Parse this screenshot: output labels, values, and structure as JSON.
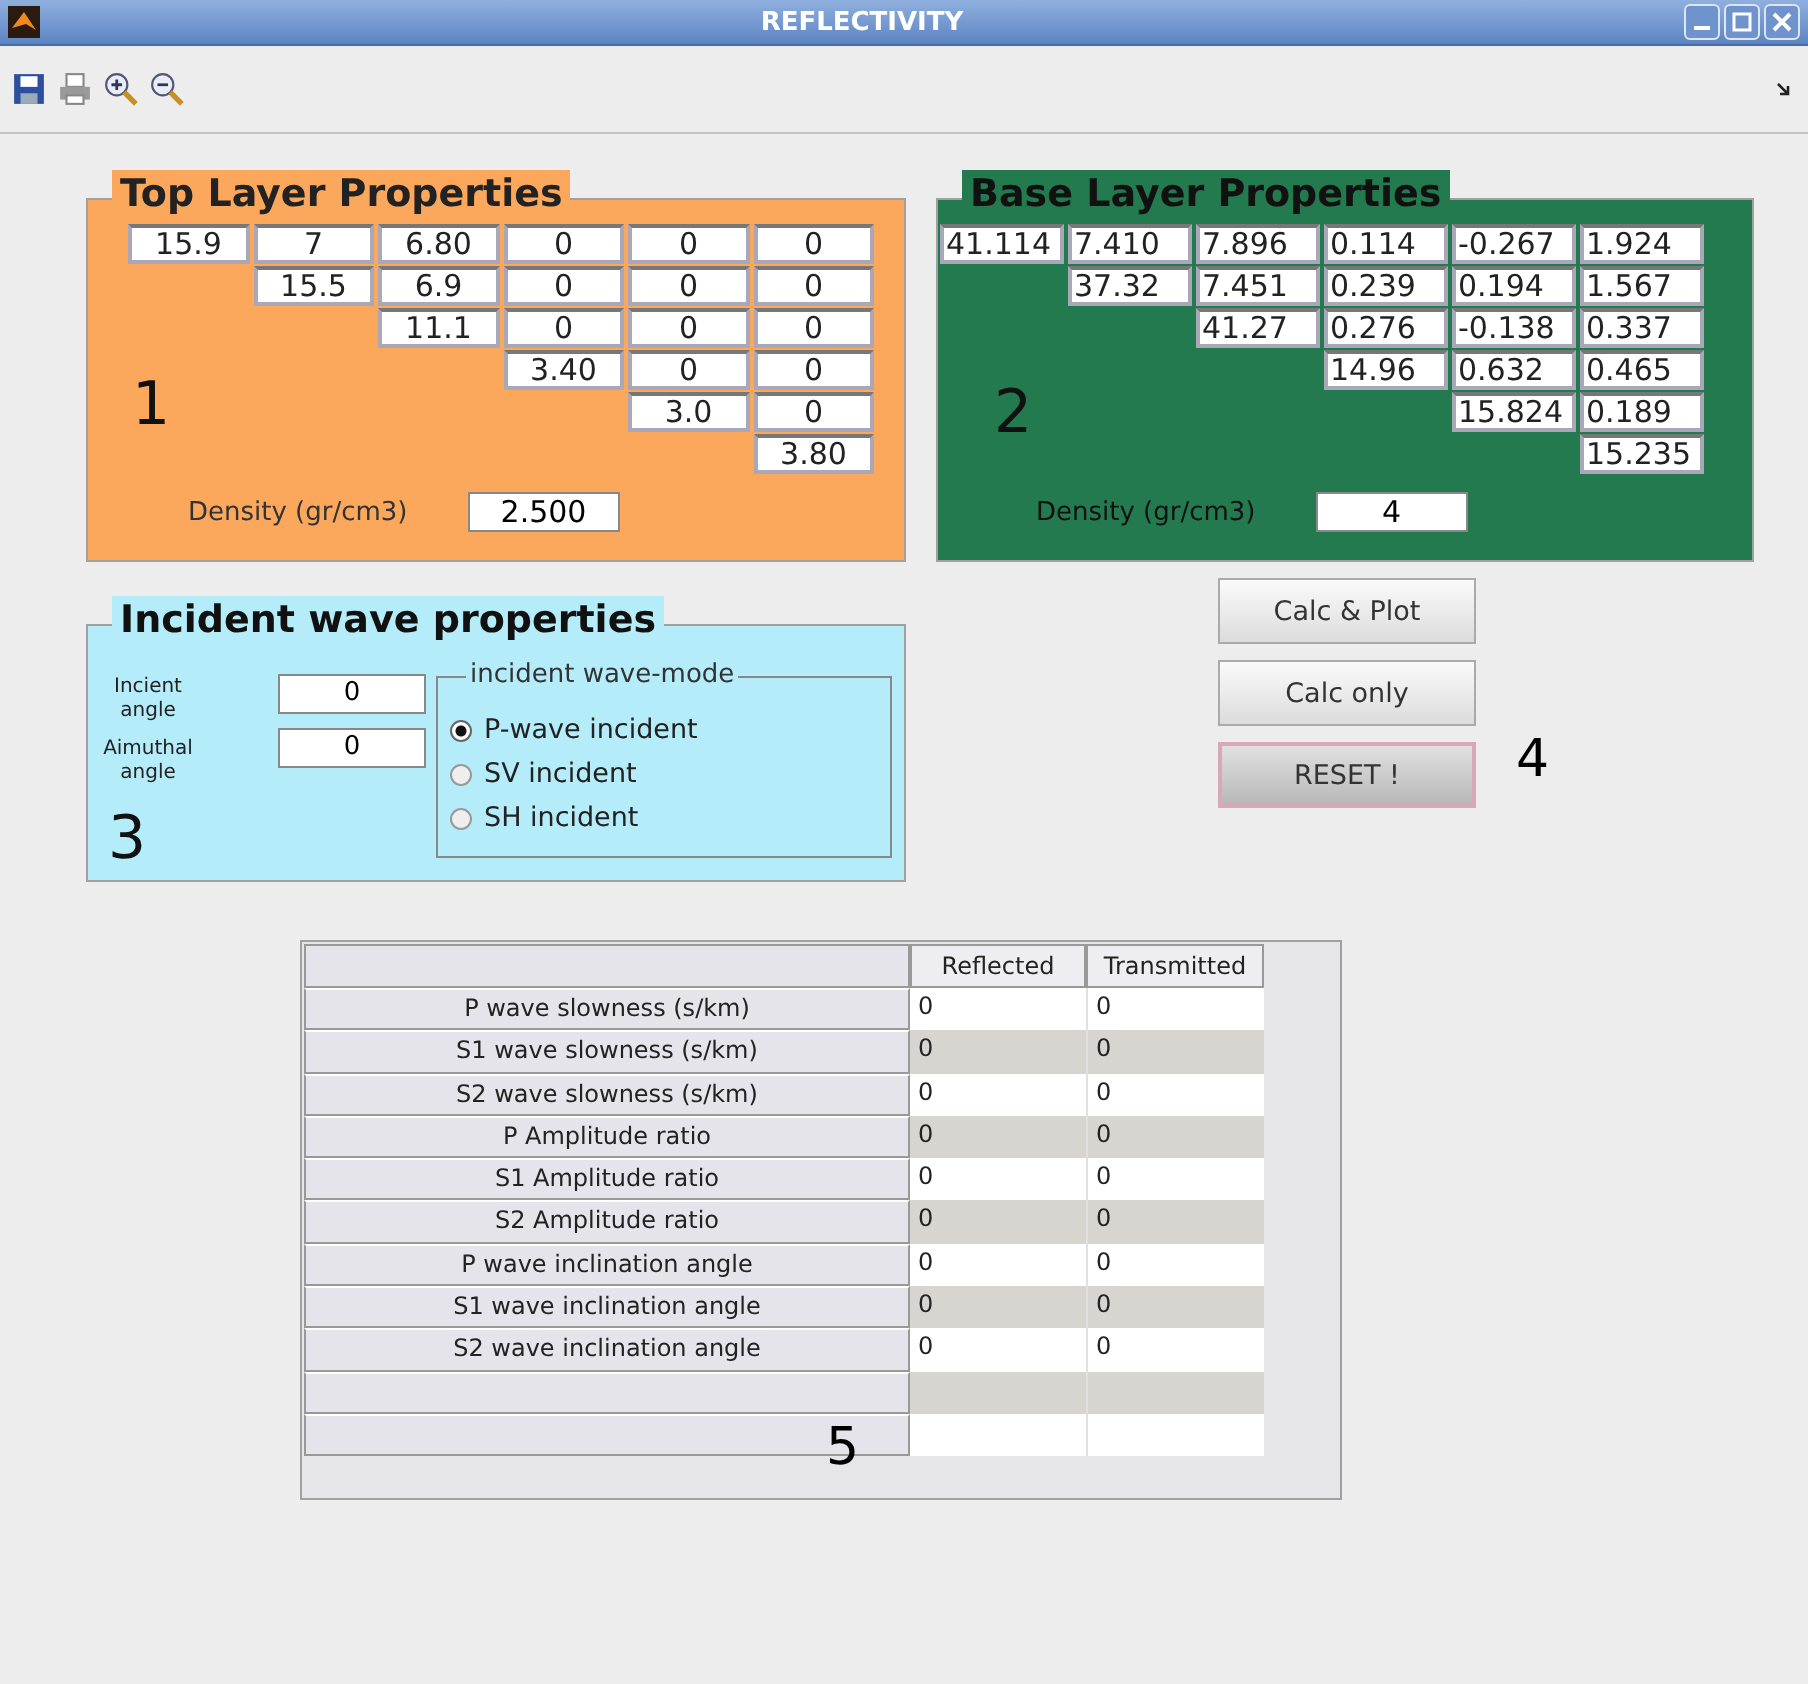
{
  "window": {
    "title": "REFLECTIVITY"
  },
  "top_layer": {
    "title": "Top Layer Properties",
    "marker": "1",
    "density_label": "Density (gr/cm3)",
    "density": "2.500",
    "matrix": [
      [
        "15.9",
        "7",
        "6.80",
        "0",
        "0",
        "0"
      ],
      [
        "15.5",
        "6.9",
        "0",
        "0",
        "0"
      ],
      [
        "11.1",
        "0",
        "0",
        "0"
      ],
      [
        "3.40",
        "0",
        "0"
      ],
      [
        "3.0",
        "0"
      ],
      [
        "3.80"
      ]
    ]
  },
  "base_layer": {
    "title": "Base Layer Properties",
    "marker": "2",
    "density_label": "Density (gr/cm3)",
    "density": "4",
    "matrix": [
      [
        "41.114",
        "7.410",
        "7.896",
        "0.114",
        "-0.267",
        "1.924"
      ],
      [
        "37.32",
        "7.451",
        "0.239",
        "0.194",
        "1.567"
      ],
      [
        "41.27",
        "0.276",
        "-0.138",
        "0.337"
      ],
      [
        "14.96",
        "0.632",
        "0.465"
      ],
      [
        "15.824",
        "0.189"
      ],
      [
        "15.235"
      ]
    ]
  },
  "incident": {
    "title": "Incident wave properties",
    "marker": "3",
    "fields": [
      {
        "label": "Incient angle",
        "value": "0"
      },
      {
        "label": "Aimuthal angle",
        "value": "0"
      }
    ],
    "mode_group": {
      "title": "incident  wave-mode",
      "options": [
        {
          "label": "P-wave incident",
          "selected": true
        },
        {
          "label": "SV incident",
          "selected": false
        },
        {
          "label": "SH incident",
          "selected": false
        }
      ]
    }
  },
  "buttons": {
    "marker": "4",
    "items": [
      {
        "label": "Calc & Plot",
        "focused": false
      },
      {
        "label": "Calc only",
        "focused": false
      },
      {
        "label": "RESET !",
        "focused": true
      }
    ]
  },
  "table": {
    "marker": "5",
    "columns": [
      "Reflected",
      "Transmitted"
    ],
    "rows": [
      {
        "kind": "data",
        "label": "P wave slowness (s/km)",
        "values": [
          "0",
          "0"
        ]
      },
      {
        "kind": "data",
        "label": "S1 wave slowness (s/km)",
        "values": [
          "0",
          "0"
        ]
      },
      {
        "kind": "data",
        "label": "S2 wave slowness (s/km)",
        "values": [
          "0",
          "0"
        ]
      },
      {
        "kind": "data",
        "label": "P Amplitude ratio",
        "values": [
          "0",
          "0"
        ]
      },
      {
        "kind": "data",
        "label": "S1 Amplitude ratio",
        "values": [
          "0",
          "0"
        ]
      },
      {
        "kind": "data",
        "label": "S2 Amplitude ratio",
        "values": [
          "0",
          "0"
        ]
      },
      {
        "kind": "data",
        "label": "P wave inclination angle",
        "values": [
          "0",
          "0"
        ]
      },
      {
        "kind": "data",
        "label": "S1 wave inclination angle",
        "values": [
          "0",
          "0"
        ]
      },
      {
        "kind": "data",
        "label": "S2 wave inclination angle",
        "values": [
          "0",
          "0"
        ]
      },
      {
        "kind": "blank"
      },
      {
        "kind": "blank"
      }
    ]
  }
}
